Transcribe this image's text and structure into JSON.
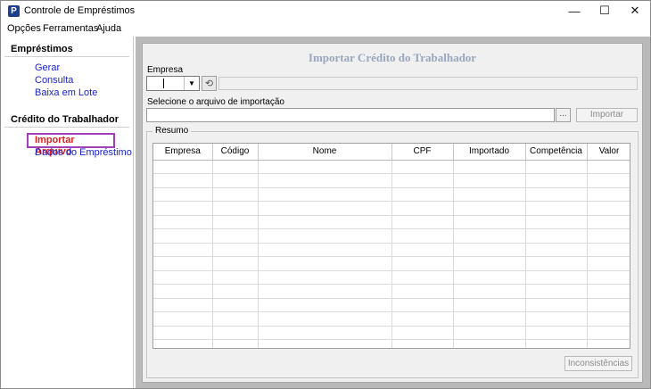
{
  "window": {
    "icon_letter": "P",
    "title": "Controle de Empréstimos",
    "controls": {
      "minimize": "—",
      "maximize": "☐",
      "close": "✕"
    }
  },
  "menu": {
    "items": [
      "Opções",
      "Ferramentas",
      "Ajuda"
    ]
  },
  "sidebar": {
    "sections": [
      {
        "heading": "Empréstimos",
        "links": [
          "Gerar",
          "Consulta",
          "Baixa em Lote"
        ]
      },
      {
        "heading": "Crédito do Trabalhador",
        "links": [
          "Importar Arquivo",
          "Dados do Empréstimo"
        ]
      }
    ],
    "active_link": "Importar Arquivo"
  },
  "form": {
    "title": "Importar Crédito do Trabalhador",
    "empresa_label": "Empresa",
    "empresa_value": "",
    "empresa_name": "",
    "dropdown_arrow": "▼",
    "refresh_glyph": "⟲",
    "file_label": "Selecione o arquivo de importação",
    "file_value": "",
    "browse_label": "...",
    "import_label": "Importar",
    "group_title": "Resumo",
    "columns": [
      "Empresa",
      "Código",
      "Nome",
      "CPF",
      "Importado",
      "Competência",
      "Valor"
    ],
    "rows": [],
    "inconsistencias_label": "Inconsistências"
  }
}
